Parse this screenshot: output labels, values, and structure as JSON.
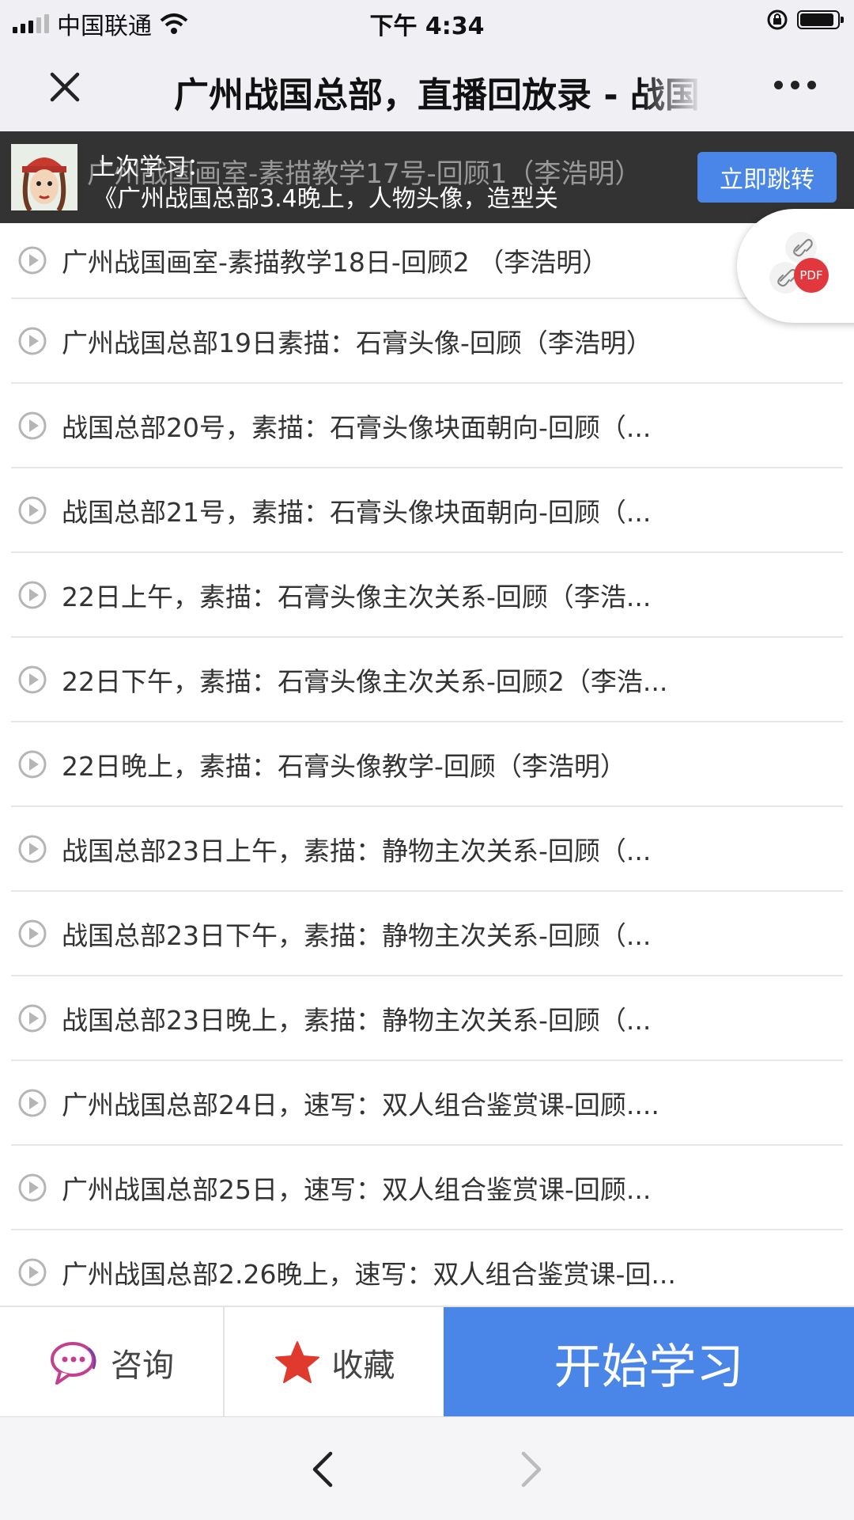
{
  "status_bar": {
    "carrier": "中国联通",
    "time": "下午 4:34"
  },
  "nav": {
    "title": "广州战国总部，直播回放录 - 战国"
  },
  "banner": {
    "ghost_text": "广州战国画室-素描教学17号-回顾1（李浩明）",
    "label": "上次学习：",
    "course": "《广州战国总部3.4晚上，人物头像，造型关",
    "jump_button": "立即跳转"
  },
  "float_menu": {
    "pdf_label": "PDF"
  },
  "list": {
    "items": [
      "广州战国画室-素描教学18日-回顾2 （李浩明）",
      "广州战国总部19日素描：石膏头像-回顾（李浩明）",
      "战国总部20号，素描：石膏头像块面朝向-回顾（...",
      "战国总部21号，素描：石膏头像块面朝向-回顾（...",
      "22日上午，素描：石膏头像主次关系-回顾（李浩...",
      "22日下午，素描：石膏头像主次关系-回顾2（李浩...",
      "22日晚上，素描：石膏头像教学-回顾（李浩明）",
      "战国总部23日上午，素描：静物主次关系-回顾（...",
      "战国总部23日下午，素描：静物主次关系-回顾（...",
      "战国总部23日晚上，素描：静物主次关系-回顾（...",
      "广州战国总部24日，速写：双人组合鉴赏课-回顾....",
      "广州战国总部25日，速写：双人组合鉴赏课-回顾...",
      "广州战国总部2.26晚上，速写：双人组合鉴赏课-回..."
    ]
  },
  "bottom_bar": {
    "consult_label": "咨询",
    "favorite_label": "收藏",
    "start_label": "开始学习"
  },
  "colors": {
    "accent": "#4a86e8",
    "consult_icon": "#c2408f",
    "favorite_icon": "#e03a2e"
  }
}
